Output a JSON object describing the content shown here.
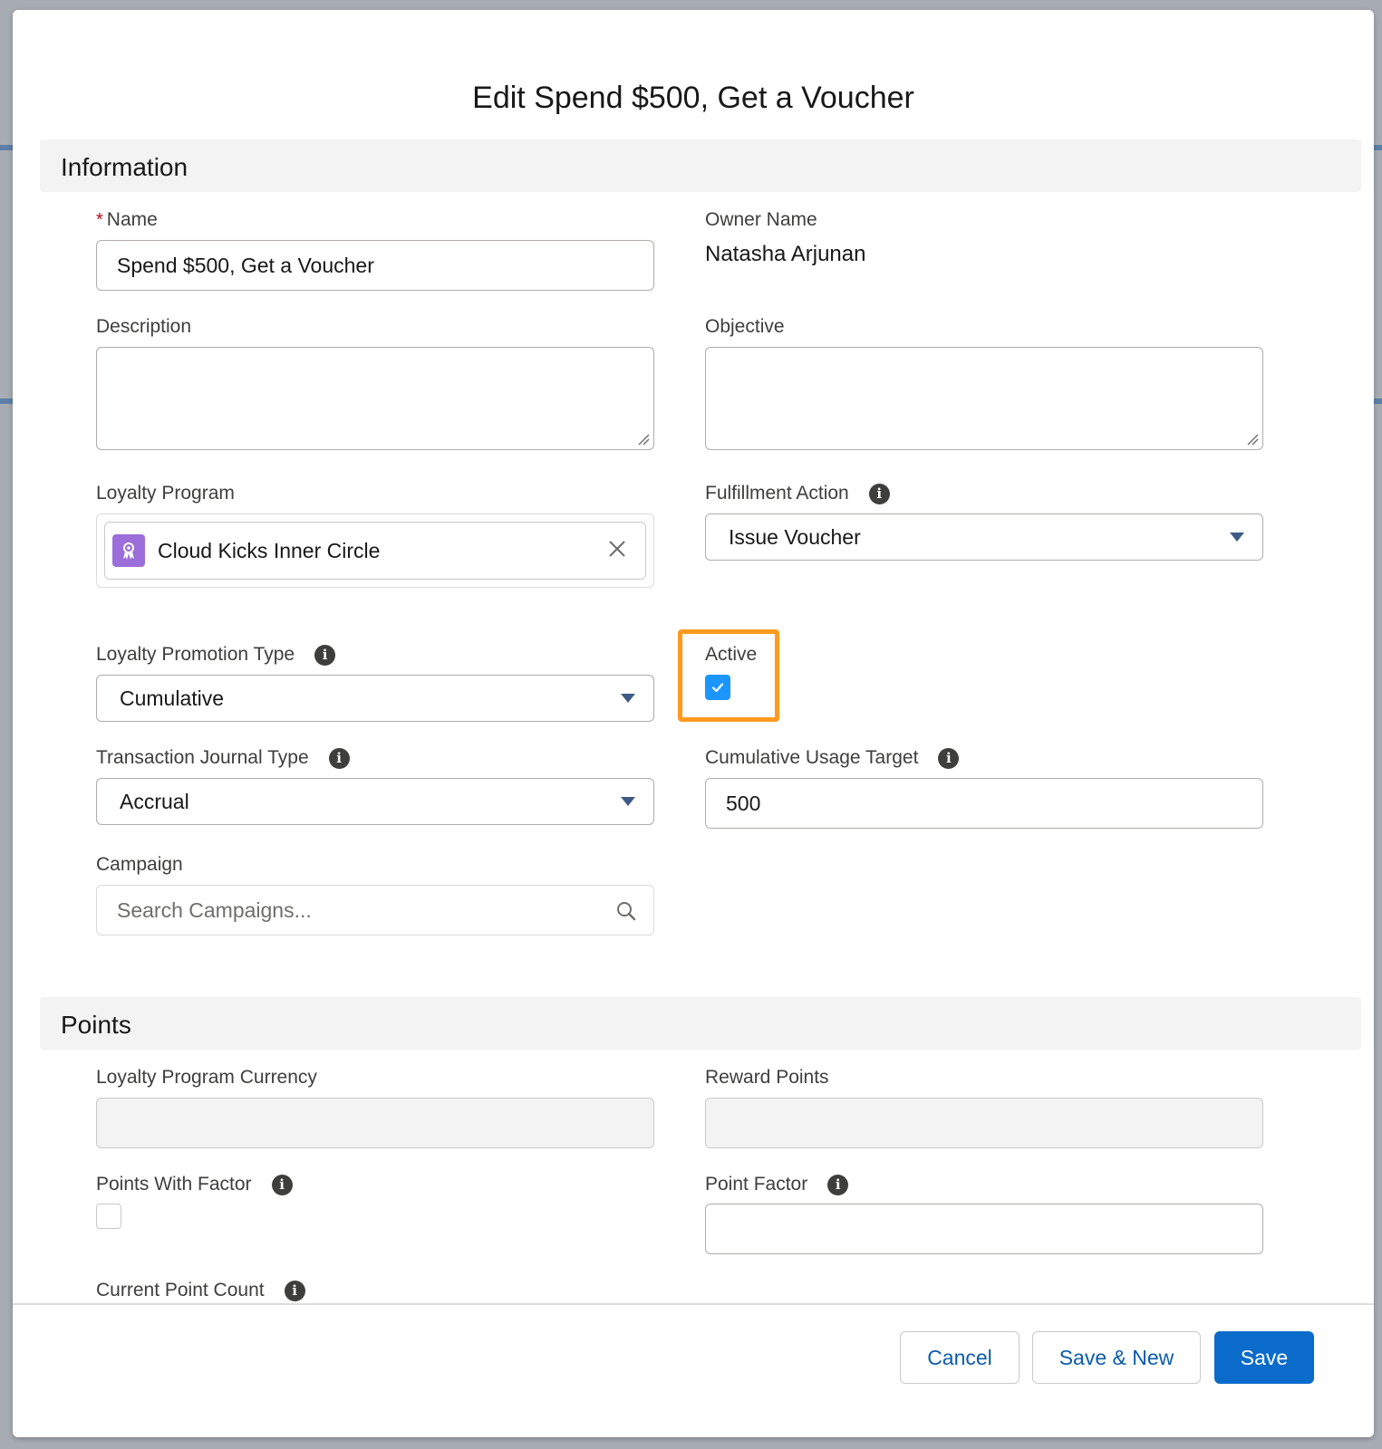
{
  "modal": {
    "title": "Edit Spend $500, Get a Voucher"
  },
  "sections": {
    "information": "Information",
    "points": "Points"
  },
  "fields": {
    "name": {
      "label": "Name",
      "required_mark": "*",
      "value": "Spend $500, Get a Voucher"
    },
    "owner_name": {
      "label": "Owner Name",
      "value": "Natasha Arjunan"
    },
    "description": {
      "label": "Description",
      "value": ""
    },
    "objective": {
      "label": "Objective",
      "value": ""
    },
    "loyalty_program": {
      "label": "Loyalty Program",
      "value": "Cloud Kicks Inner Circle",
      "icon": "loyalty-program-icon"
    },
    "fulfillment_action": {
      "label": "Fulfillment Action",
      "value": "Issue Voucher"
    },
    "loyalty_promotion_type": {
      "label": "Loyalty Promotion Type",
      "value": "Cumulative"
    },
    "active": {
      "label": "Active",
      "checked": true
    },
    "transaction_journal_type": {
      "label": "Transaction Journal Type",
      "value": "Accrual"
    },
    "cumulative_usage_target": {
      "label": "Cumulative Usage Target",
      "value": "500"
    },
    "campaign": {
      "label": "Campaign",
      "placeholder": "Search Campaigns..."
    },
    "loyalty_program_currency": {
      "label": "Loyalty Program Currency",
      "value": ""
    },
    "reward_points": {
      "label": "Reward Points",
      "value": ""
    },
    "points_with_factor": {
      "label": "Points With Factor",
      "checked": false
    },
    "point_factor": {
      "label": "Point Factor",
      "value": ""
    },
    "current_point_count": {
      "label": "Current Point Count"
    }
  },
  "footer": {
    "cancel_label": "Cancel",
    "save_new_label": "Save & New",
    "save_label": "Save"
  },
  "colors": {
    "brand": "#0b6bcb",
    "checkbox_checked": "#1b96ff",
    "highlight": "#ff9a1f",
    "required": "#ba0517"
  }
}
